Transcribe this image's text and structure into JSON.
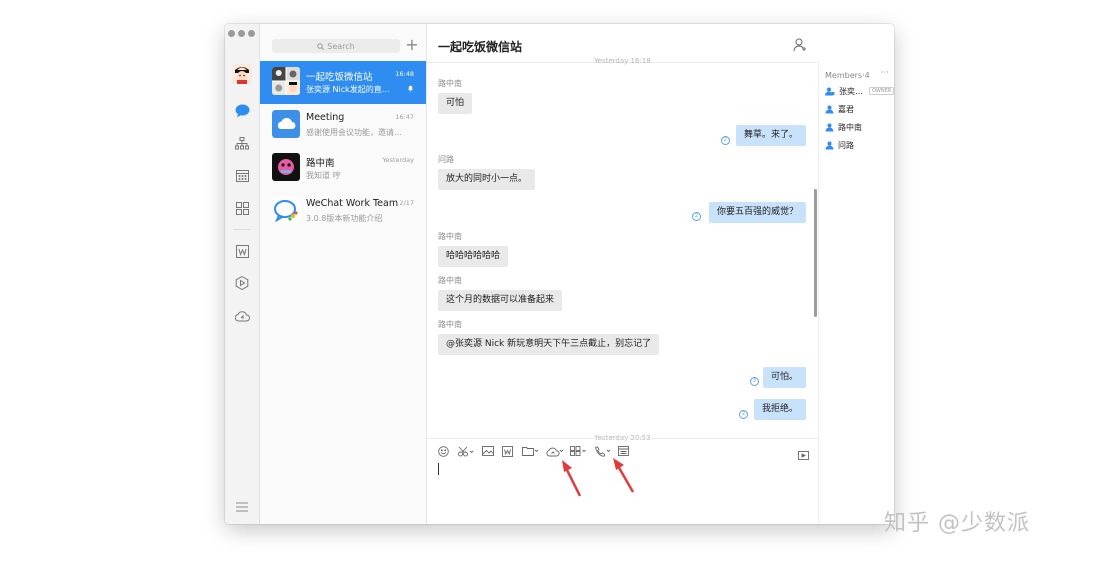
{
  "colors": {
    "accent": "#2f8cf1",
    "bubble_me": "#c9e2fb",
    "bubble_other": "#e9e9ea",
    "arrow": "#e23b3b"
  },
  "sidebar": {
    "icons": [
      "chat-icon",
      "org-chart-icon",
      "calendar-icon",
      "apps-grid-icon",
      "document-w-icon",
      "hexagon-icon",
      "cloud-drive-icon",
      "menu-icon"
    ]
  },
  "search": {
    "placeholder": "Search"
  },
  "conversations": [
    {
      "name": "一起吃饭微信站",
      "time": "16:48",
      "preview": "张奕源 Nick发起的直…",
      "muted": true
    },
    {
      "name": "Meeting",
      "time": "16:47",
      "preview": "感谢使用会议功能，邀请…"
    },
    {
      "name": "路中南",
      "time": "Yesterday",
      "preview": "我知道 哼"
    },
    {
      "name": "WeChat Work Team",
      "time": "2/17",
      "preview": "3.0.8版本新功能介绍"
    }
  ],
  "chat": {
    "title": "一起吃饭微信站",
    "date_top": "Yesterday 16:18",
    "date_bottom": "Yesterday 20:53",
    "messages": [
      {
        "sender": "路中南",
        "text": "可怕"
      },
      {
        "text": "舞草。来了。",
        "read": "2"
      },
      {
        "sender": "问路",
        "text": "放大的同时小一点。"
      },
      {
        "text": "你要五百强的威觉？",
        "read": "2"
      },
      {
        "sender": "路中南",
        "text": "哈哈哈哈哈哈"
      },
      {
        "sender": "路中南",
        "text": "这个月的数据可以准备起来"
      },
      {
        "sender": "路中南",
        "text": "@张奕源 Nick 新玩意明天下午三点截止，别忘记了"
      },
      {
        "text": "可怕。",
        "read": "3"
      },
      {
        "text": "我拒绝。",
        "read": "2"
      }
    ]
  },
  "members": {
    "title": "Members·4",
    "more": "···",
    "owner_badge": "OWNER",
    "list": [
      "张奕…",
      "嘉君",
      "路中南",
      "问路"
    ]
  },
  "watermark": "知乎 @少数派"
}
